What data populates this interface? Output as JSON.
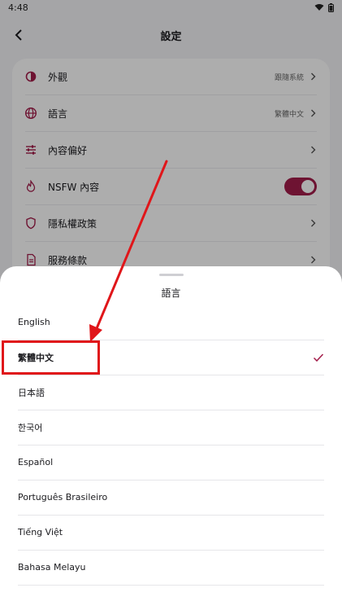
{
  "status_bar": {
    "time": "4:48"
  },
  "header": {
    "title": "設定"
  },
  "settings": [
    {
      "label": "外觀",
      "value": "跟隨系統",
      "icon": "appearance-icon"
    },
    {
      "label": "語言",
      "value": "繁體中文",
      "icon": "globe-icon"
    },
    {
      "label": "內容偏好",
      "value": "",
      "icon": "sliders-icon"
    },
    {
      "label": "NSFW 內容",
      "value": "",
      "icon": "flame-icon",
      "toggle": true
    },
    {
      "label": "隱私權政策",
      "value": "",
      "icon": "shield-icon"
    },
    {
      "label": "服務條款",
      "value": "",
      "icon": "document-icon"
    }
  ],
  "sheet": {
    "title": "語言",
    "languages": [
      {
        "label": "English"
      },
      {
        "label": "繁體中文",
        "selected": true
      },
      {
        "label": "日本語"
      },
      {
        "label": "한국어"
      },
      {
        "label": "Español"
      },
      {
        "label": "Português Brasileiro"
      },
      {
        "label": "Tiếng Việt"
      },
      {
        "label": "Bahasa Melayu"
      }
    ]
  },
  "colors": {
    "accent": "#a31d4a",
    "annotation": "#e0161a"
  }
}
